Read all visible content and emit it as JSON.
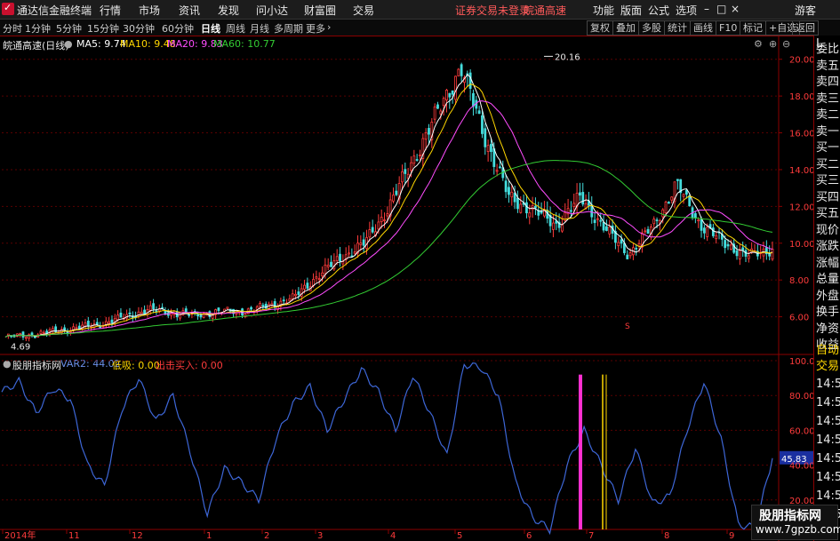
{
  "app": {
    "title": "通达信金融终端"
  },
  "menu": {
    "items": [
      "行情",
      "市场",
      "资讯",
      "发现",
      "问小达",
      "财富圈",
      "交易"
    ],
    "notice": "证券交易未登录",
    "stock": "皖通高速",
    "right_items": [
      "功能",
      "版面",
      "公式",
      "选项"
    ],
    "guest": "游客",
    "win_controls": [
      "–",
      "□",
      "×"
    ]
  },
  "periods": [
    "分时",
    "1分钟",
    "5分钟",
    "15分钟",
    "30分钟",
    "60分钟",
    "日线",
    "周线",
    "月线",
    "多周期",
    "更多"
  ],
  "active_period": "日线",
  "toolbar": [
    "复权",
    "叠加",
    "多股",
    "统计",
    "画线",
    "F10",
    "标记",
    "+自选",
    "返回"
  ],
  "main": {
    "stock_title": "皖通高速(日线)",
    "ma5": "MA5: 9.74",
    "ma10": "MA10: 9.48",
    "ma20": "MA20: 9.83",
    "ma60": "MA60: 10.77",
    "high_label": "20.16",
    "low_label": "4.69",
    "s_marker": "S",
    "ma5_color": "#ffffff",
    "ma10_color": "#ffd700",
    "ma20_color": "#ff4dff",
    "ma60_color": "#33cc33",
    "up_color": "#ff3b3b",
    "down_color": "#44dddd",
    "y_labels": [
      "20.00",
      "18.00",
      "16.00",
      "14.00",
      "12.00",
      "10.00",
      "8.00",
      "6.00"
    ]
  },
  "chart_data": [
    {
      "type": "candlestick",
      "title": "皖通高速(日线)",
      "x_ticks": [
        "2014年",
        "11",
        "12",
        "1",
        "2",
        "3",
        "4",
        "5",
        "6",
        "7",
        "8",
        "9"
      ],
      "ylim": [
        4.0,
        21.0
      ],
      "close_approx": [
        4.9,
        5.0,
        5.2,
        5.4,
        5.6,
        6.0,
        6.4,
        6.2,
        6.1,
        6.3,
        6.3,
        6.6,
        7.0,
        8.2,
        9.2,
        10.0,
        12.0,
        14.5,
        17.0,
        19.6,
        15.8,
        12.5,
        11.8,
        11.0,
        12.5,
        10.8,
        9.4,
        10.9,
        13.2,
        11.0,
        10.0,
        9.3,
        9.7
      ],
      "annotations": {
        "high": 20.16,
        "low": 4.69
      },
      "grid": true
    },
    {
      "type": "line",
      "title": "股朋指标网",
      "series": [
        {
          "name": "VAR2",
          "last": 44.02
        }
      ],
      "ylim": [
        0,
        100
      ],
      "y_ticks": [
        20.0,
        40.0,
        60.0,
        80.0,
        100.0
      ],
      "values": [
        82,
        88,
        70,
        84,
        78,
        40,
        28,
        72,
        90,
        65,
        80,
        48,
        12,
        38,
        30,
        20,
        55,
        75,
        85,
        60,
        78,
        95,
        82,
        60,
        92,
        70,
        45,
        98,
        96,
        80,
        30,
        10,
        3,
        40,
        60,
        40,
        20,
        50,
        18,
        22,
        60,
        88,
        55,
        6,
        4,
        44
      ]
    }
  ],
  "sub": {
    "title": "股朋指标网",
    "var2": "VAR2: 44.02",
    "low": "低吸: 0.00",
    "buy": "出击买入: 0.00",
    "cursor_value": "45.83",
    "y_labels": [
      "100.0",
      "80.00",
      "60.00",
      "40.00",
      "20.00"
    ]
  },
  "right_panel": {
    "top": "L",
    "items": [
      "委比",
      "卖五",
      "卖四",
      "卖三",
      "卖二",
      "卖一",
      "买一",
      "买二",
      "买三",
      "买四",
      "买五",
      "现价",
      "涨跌",
      "涨幅",
      "总量",
      "外盘",
      "换手",
      "净资",
      "收益"
    ],
    "bottom_items": [
      "自动",
      "交易"
    ],
    "times": [
      "14:5",
      "14:5",
      "14:5",
      "14:5",
      "14:5",
      "14:5",
      "14:5",
      "14:5"
    ]
  },
  "watermark": {
    "name": "股朋指标网",
    "url": "www.7gpzb.com"
  }
}
